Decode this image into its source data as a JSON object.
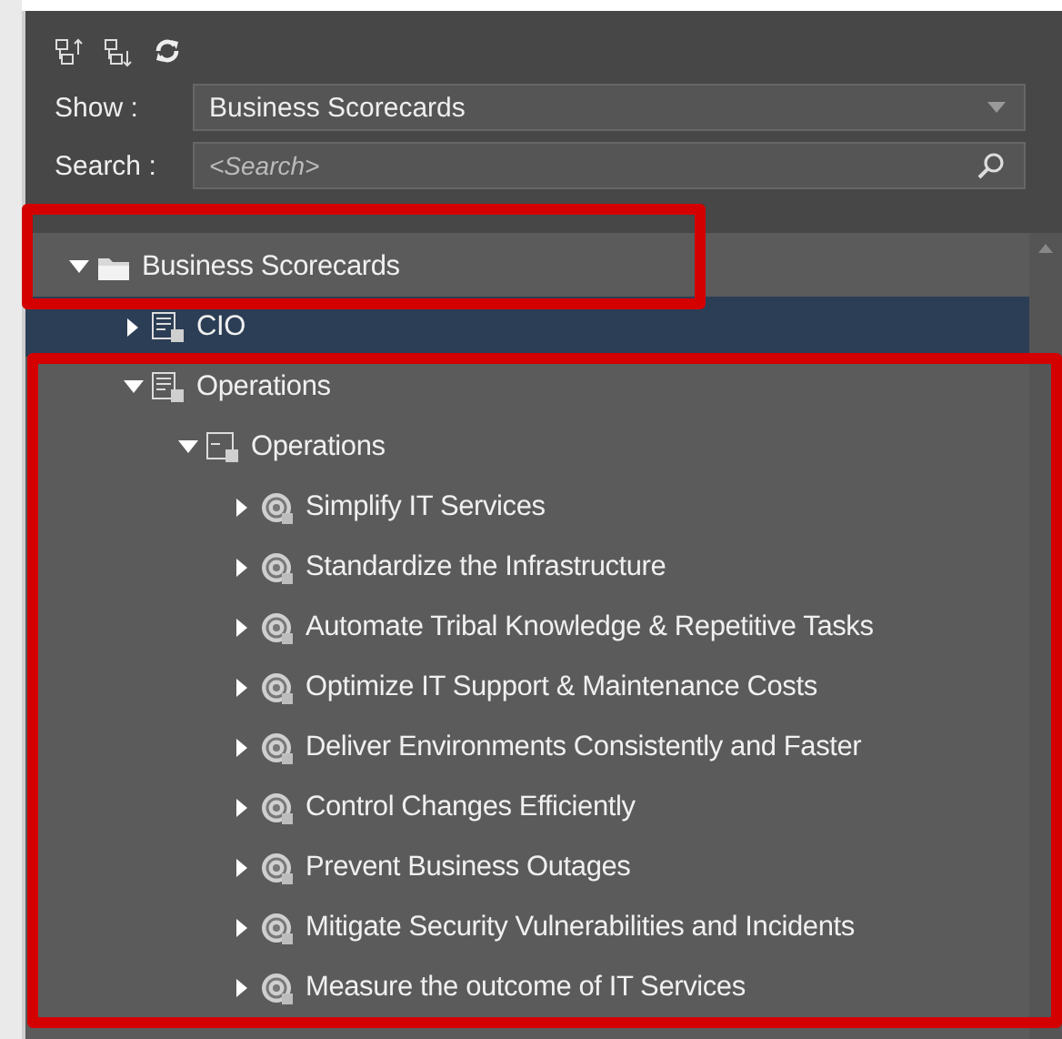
{
  "toolbar": {
    "buttons": [
      {
        "kind": "expand"
      },
      {
        "kind": "collapse"
      },
      {
        "kind": "refresh"
      }
    ]
  },
  "show": {
    "label": "Show :",
    "value": "Business Scorecards"
  },
  "search": {
    "label": "Search :",
    "placeholder": "<Search>"
  },
  "tree": [
    {
      "label": "Business Scorecards",
      "kind": "folder",
      "expanded": true,
      "selected": false,
      "children": [
        {
          "label": "CIO",
          "kind": "scorecard",
          "expanded": false,
          "selected": true
        },
        {
          "label": "Operations",
          "kind": "scorecard",
          "expanded": true,
          "selected": false,
          "children": [
            {
              "label": "Operations",
              "kind": "perspective",
              "expanded": true,
              "selected": false,
              "children": [
                {
                  "label": "Simplify IT Services",
                  "kind": "objective",
                  "expanded": false,
                  "selected": false
                },
                {
                  "label": "Standardize the Infrastructure",
                  "kind": "objective",
                  "expanded": false,
                  "selected": false
                },
                {
                  "label": "Automate Tribal Knowledge & Repetitive Tasks",
                  "kind": "objective",
                  "expanded": false,
                  "selected": false
                },
                {
                  "label": "Optimize IT Support & Maintenance Costs",
                  "kind": "objective",
                  "expanded": false,
                  "selected": false
                },
                {
                  "label": "Deliver Environments Consistently and Faster",
                  "kind": "objective",
                  "expanded": false,
                  "selected": false
                },
                {
                  "label": "Control Changes Efficiently",
                  "kind": "objective",
                  "expanded": false,
                  "selected": false
                },
                {
                  "label": "Prevent Business Outages",
                  "kind": "objective",
                  "expanded": false,
                  "selected": false
                },
                {
                  "label": "Mitigate Security Vulnerabilities and Incidents",
                  "kind": "objective",
                  "expanded": false,
                  "selected": false
                },
                {
                  "label": "Measure the outcome of IT Services",
                  "kind": "objective",
                  "expanded": false,
                  "selected": false
                }
              ]
            }
          ]
        }
      ]
    }
  ]
}
